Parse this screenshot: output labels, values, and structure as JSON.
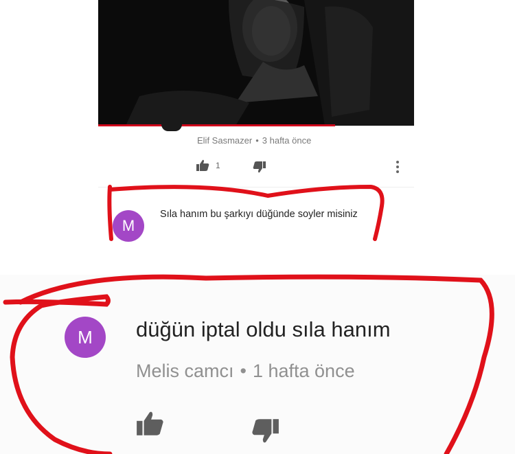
{
  "video": {
    "thumbnail_icon": "portrait-photo",
    "progress_fraction": 0.75
  },
  "comment_1_meta": {
    "author": "Elif Sasmazer",
    "separator": "•",
    "time": "3 hafta önce",
    "like_count": "1"
  },
  "reply_1": {
    "avatar_letter": "M",
    "text": "Sıla hanım bu şarkıyı düğünde soyler misiniz"
  },
  "reply_2": {
    "avatar_letter": "M",
    "text": "düğün iptal oldu sıla hanım",
    "author": "Melis camcı",
    "separator": "•",
    "time": "1 hafta önce"
  },
  "colors": {
    "avatar": "#a347c6",
    "annotation_red": "#e0111a",
    "progress_red": "#d0021b"
  },
  "icons": [
    "thumbs-up-icon",
    "thumbs-down-icon",
    "more-vertical-icon"
  ]
}
